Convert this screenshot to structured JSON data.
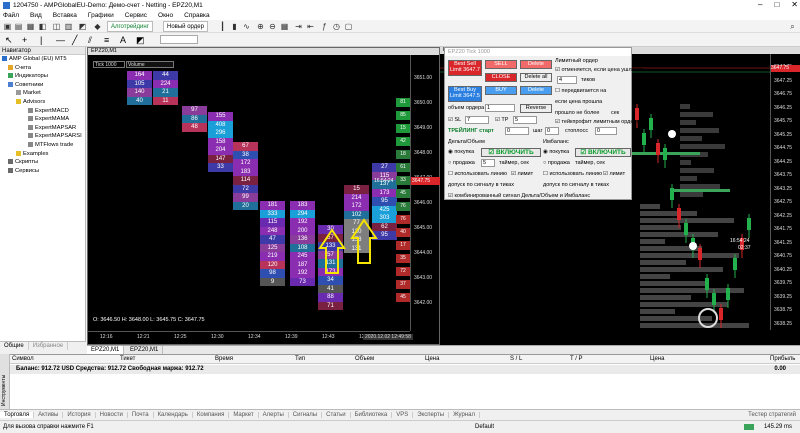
{
  "window": {
    "title": "1204750 - AMPGlobalEU-Demo: Демо-счет - Netting - EPZ20,M1",
    "min": "–",
    "max": "□",
    "close": "✕"
  },
  "menu": [
    "Файл",
    "Вид",
    "Вставка",
    "Графики",
    "Сервис",
    "Окно",
    "Справка"
  ],
  "toolbar": {
    "algo": "Алготрейдинг",
    "new_order": "Новый ордер"
  },
  "navigator": {
    "title": "Навигатор",
    "items": [
      "AMP Global (EU) MT5",
      "Счета",
      "Индикаторы",
      "Советники",
      "Market",
      "Advisors",
      "ExpertMACD",
      "ExpertMAMA",
      "ExpertMAPSAR",
      "ExpertMAPSARSI",
      "MTFlows trade",
      "Examples",
      "Скрипты",
      "Сервисы"
    ],
    "tabs": [
      "Общие",
      "Избранное"
    ]
  },
  "chart1": {
    "tab": "EPZ20,M1",
    "tick_label": "Tick 1000",
    "mode": "Volume",
    "prices": [
      "3651.00",
      "3650.00",
      "3649.00",
      "3648.00",
      "3647.00",
      "3646.00",
      "3645.00",
      "3644.00",
      "3643.00",
      "3642.00"
    ],
    "times": [
      "12:16",
      "12:21",
      "12:25",
      "12:30",
      "12:34",
      "12:39",
      "12:43",
      "12:45"
    ],
    "ohlc": "O: 3646.50  H: 3648.00  L: 3645.75  C: 3647.75",
    "time_marker": "2020.12.02 12:49:58",
    "last_price": "3647.75",
    "countdown": "16:54:24",
    "side_vals": [
      "81",
      "85",
      "15",
      "42",
      "18",
      "61",
      "33",
      "45",
      "76",
      "76",
      "40",
      "17",
      "35",
      "72",
      "37",
      "45"
    ],
    "clusters": [
      [
        "164",
        "105",
        "140",
        "40"
      ],
      [
        "44",
        "224",
        "21",
        "11"
      ],
      [
        "97",
        "86",
        "48"
      ],
      [
        "155",
        "408",
        "296",
        "158",
        "204",
        "147",
        "33"
      ],
      [
        "67",
        "38",
        "172",
        "183",
        "114",
        "72",
        "99",
        "20"
      ],
      [
        "181",
        "333",
        "115",
        "248",
        "47",
        "125",
        "219",
        "120",
        "98",
        "9"
      ],
      [
        "183",
        "294",
        "192",
        "200",
        "136",
        "108",
        "245",
        "187",
        "192",
        "73"
      ],
      [
        "30",
        "57",
        "133",
        "57",
        "131",
        "173",
        "34",
        "41",
        "88",
        "71"
      ],
      [
        "15",
        "214",
        "172",
        "102",
        "77",
        "120",
        "158",
        "131"
      ],
      [
        "27",
        "115",
        "137",
        "173",
        "95",
        "425",
        "303",
        "62",
        "95"
      ]
    ]
  },
  "panel": {
    "title": "EPZ20  Tick 1000",
    "best_sell": "Best Sell\nLimit 3647.7",
    "sell": "SELL",
    "delete": "Delete",
    "close": "CLOSE",
    "delete_all": "Delete all",
    "best_buy": "Best Buy\nLimit 3647.5",
    "buy": "BUY",
    "delete2": "Delete",
    "volume_label": "объем ордера",
    "volume": "1",
    "reverse": "Reverse",
    "sl_label": "SL",
    "sl": "7",
    "tp_label": "TP",
    "tp": "5",
    "trailing": "ТРЕЙЛИНГ старт",
    "trail_start": "0",
    "step": "шаг",
    "trail_step": "0",
    "pending_title": "Лимитный ордер",
    "pending_1": "отменяется, если цена ушла на",
    "pending_ticks": "4",
    "ticks": "тиков",
    "pending_2": "передвигается на",
    "pending_3": "если цена прошла",
    "pending_4": "прошло не более",
    "sec": "сек",
    "pending_5": "тейкпрофит лимитным ордером",
    "stop_label": "стоплосс",
    "stop": "0",
    "delta_title": "Дельта/Объем",
    "imb_title": "Имбаланс",
    "buy_r": "покупка",
    "sell_r": "продажа",
    "enable": "ВКЛЮЧИТЬ",
    "timer": "таймер, сек",
    "use_line": "использовать линию",
    "limit": "лимит",
    "tolerance": "допуск по сигналу в тиках",
    "combined": "комбинированный сигнал Дельта/Объем и Имбаланс"
  },
  "chart2": {
    "title": "EPZ20,M1",
    "prices": [
      "3647.75",
      "3647.25",
      "3646.75",
      "3646.25",
      "3645.75",
      "3645.25",
      "3644.75",
      "3644.25",
      "3643.75",
      "3643.25",
      "3642.75",
      "3642.25",
      "3641.75",
      "3641.25",
      "3640.75",
      "3640.25",
      "3639.75",
      "3639.25",
      "3638.75",
      "3638.25"
    ],
    "last": "3647.75",
    "countdown": "16:54:24",
    "secs": "02:37"
  },
  "tabs": [
    "EPZ20,M1",
    "EPZ20,M1"
  ],
  "terminal": {
    "cols": [
      "Символ",
      "Тикет",
      "Время",
      "Тип",
      "Объем",
      "Цена",
      "S / L",
      "T / P",
      "Цена",
      "Прибыль"
    ],
    "balance": "Баланс: 912.72 USD   Средства: 912.72   Свободная маржа: 912.72",
    "profit": "0.00",
    "side": "Инструменты",
    "tabs": [
      "Торговля",
      "Активы",
      "История",
      "Новости",
      "Почта",
      "Календарь",
      "Компания",
      "Маркет",
      "Алерты",
      "Сигналы",
      "Статьи",
      "Библиотека",
      "VPS",
      "Эксперты",
      "Журнал"
    ],
    "tester": "Тестер стратегий"
  },
  "status": {
    "help": "Для вызова справки нажмите F1",
    "mode": "Default",
    "ping": "145.29 ms"
  },
  "colors": {
    "accent": "#2a6fc9",
    "bull": "#22b14c",
    "bear": "#d8262b"
  }
}
